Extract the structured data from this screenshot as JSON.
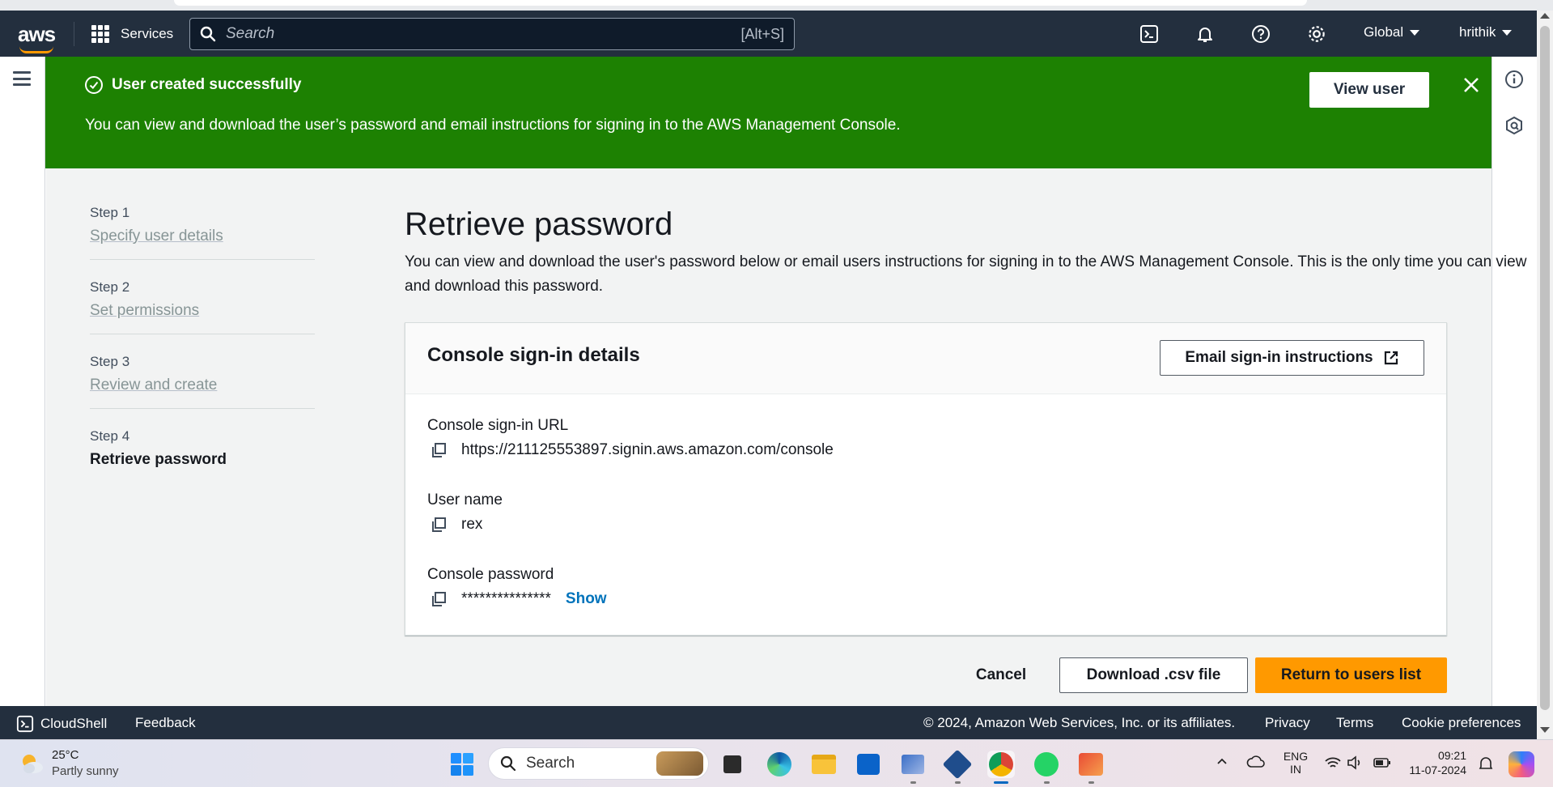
{
  "nav": {
    "logo": "aws",
    "services_label": "Services",
    "search_placeholder": "Search",
    "search_shortcut": "[Alt+S]",
    "region": "Global",
    "user": "hrithik"
  },
  "flash": {
    "title": "User created successfully",
    "message": "You can view and download the user’s password and email instructions for signing in to the AWS Management Console.",
    "view_user_label": "View user"
  },
  "steps": [
    {
      "step": "Step 1",
      "label": "Specify user details"
    },
    {
      "step": "Step 2",
      "label": "Set permissions"
    },
    {
      "step": "Step 3",
      "label": "Review and create"
    },
    {
      "step": "Step 4",
      "label": "Retrieve password"
    }
  ],
  "page": {
    "title": "Retrieve password",
    "description": "You can view and download the user's password below or email users instructions for signing in to the AWS Management Console. This is the only time you can view and download this password."
  },
  "card": {
    "title": "Console sign-in details",
    "email_button": "Email sign-in instructions",
    "url_label": "Console sign-in URL",
    "url_value": "https://211125553897.signin.aws.amazon.com/console",
    "username_label": "User name",
    "username_value": "rex",
    "password_label": "Console password",
    "password_value": "***************",
    "show_label": "Show"
  },
  "actions": {
    "cancel": "Cancel",
    "download": "Download .csv file",
    "return": "Return to users list"
  },
  "footer": {
    "cloudshell": "CloudShell",
    "feedback": "Feedback",
    "copyright": "© 2024, Amazon Web Services, Inc. or its affiliates.",
    "privacy": "Privacy",
    "terms": "Terms",
    "cookies": "Cookie preferences"
  },
  "taskbar": {
    "weather_temp": "25°C",
    "weather_desc": "Partly sunny",
    "search_label": "Search",
    "lang_top": "ENG",
    "lang_bottom": "IN",
    "time": "09:21",
    "date": "11-07-2024"
  },
  "colors": {
    "nav_bg": "#232f3e",
    "success_green": "#1d8102",
    "primary_orange": "#ff9900",
    "link_blue": "#0073bb"
  }
}
